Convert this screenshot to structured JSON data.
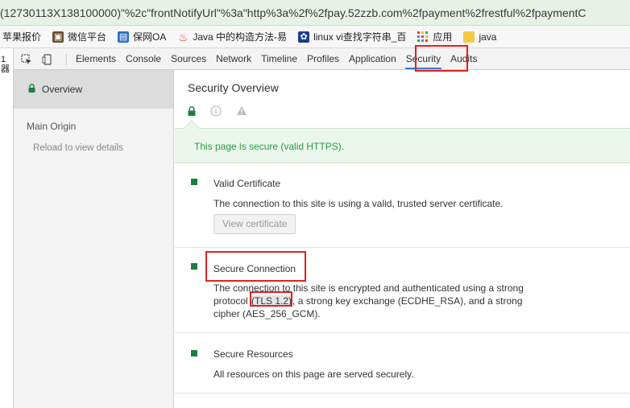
{
  "url": "(12730113X138100000)\"%2c\"frontNotifyUrl\"%3a\"http%3a%2f%2fpay.52zzb.com%2fpayment%2frestful%2fpaymentC",
  "bookmarks": [
    {
      "label": "苹果报价",
      "icon": "none"
    },
    {
      "label": "微信平台",
      "icon": "image-icon"
    },
    {
      "label": "保网OA",
      "icon": "oa-icon"
    },
    {
      "label": "Java 中的构造方法-易",
      "icon": "java-icon"
    },
    {
      "label": "linux vi查找字符串_百",
      "icon": "paw-icon"
    },
    {
      "label": "应用",
      "icon": "apps-grid-icon"
    },
    {
      "label": "java",
      "icon": "folder-icon"
    }
  ],
  "left_strip_text": "1\n器",
  "devtools": {
    "tabs": [
      "Elements",
      "Console",
      "Sources",
      "Network",
      "Timeline",
      "Profiles",
      "Application",
      "Security",
      "Audits"
    ],
    "active_tab": "Security"
  },
  "sidebar": {
    "overview": "Overview",
    "main_origin": "Main Origin",
    "reload": "Reload to view details"
  },
  "main": {
    "title": "Security Overview",
    "summary": "This page is secure (valid HTTPS).",
    "sections": {
      "cert": {
        "title": "Valid Certificate",
        "body": "The connection to this site is using a valid, trusted server certificate.",
        "button": "View certificate"
      },
      "conn": {
        "title": "Secure Connection",
        "body_pre": "The connection to this site is encrypted and authenticated using a strong protocol ",
        "tls": "(TLS 1.2)",
        "body_post": ", a strong key exchange (ECDHE_RSA), and a strong cipher (AES_256_GCM)."
      },
      "res": {
        "title": "Secure Resources",
        "body": "All resources on this page are served securely."
      }
    }
  },
  "colors": {
    "secure_green": "#1e7d3f",
    "summary_text": "#2a9a3f",
    "summary_bg": "#eaf6ec",
    "highlight_red": "#e02020",
    "tab_underline": "#3879d9"
  }
}
